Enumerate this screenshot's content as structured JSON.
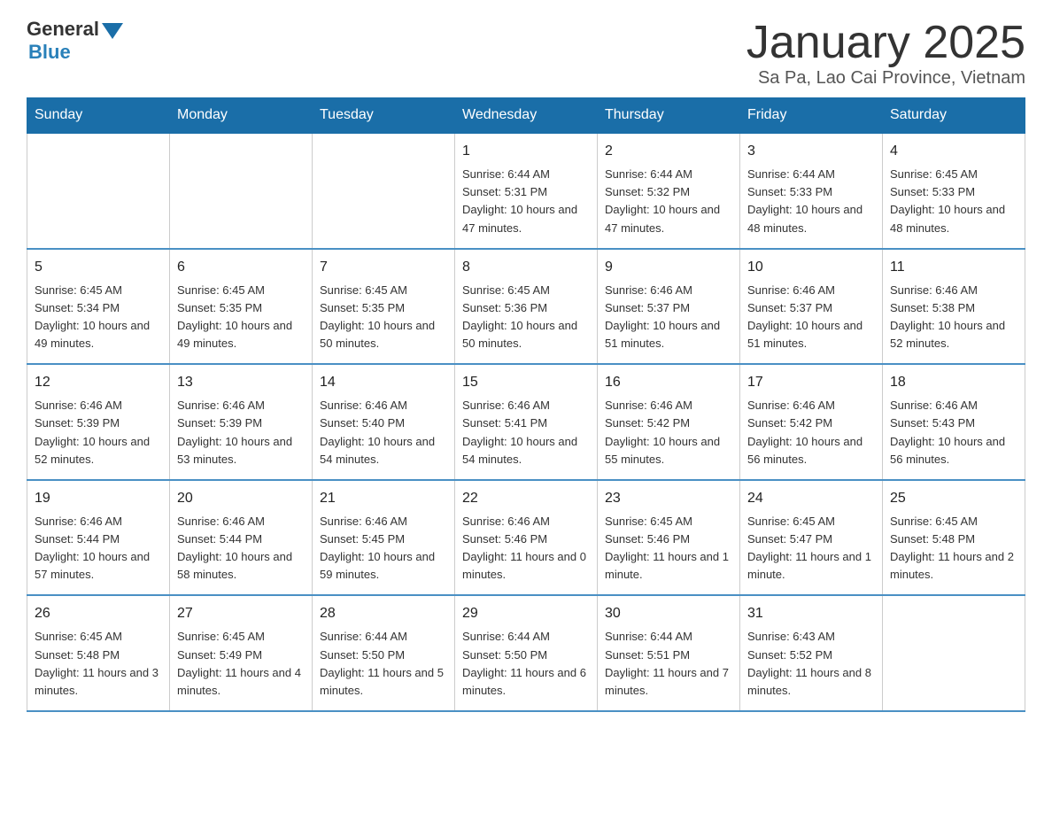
{
  "header": {
    "logo_general": "General",
    "logo_blue": "Blue",
    "title": "January 2025",
    "subtitle": "Sa Pa, Lao Cai Province, Vietnam"
  },
  "calendar": {
    "days_of_week": [
      "Sunday",
      "Monday",
      "Tuesday",
      "Wednesday",
      "Thursday",
      "Friday",
      "Saturday"
    ],
    "weeks": [
      {
        "cells": [
          {
            "day": "",
            "info": ""
          },
          {
            "day": "",
            "info": ""
          },
          {
            "day": "",
            "info": ""
          },
          {
            "day": "1",
            "info": "Sunrise: 6:44 AM\nSunset: 5:31 PM\nDaylight: 10 hours and 47 minutes."
          },
          {
            "day": "2",
            "info": "Sunrise: 6:44 AM\nSunset: 5:32 PM\nDaylight: 10 hours and 47 minutes."
          },
          {
            "day": "3",
            "info": "Sunrise: 6:44 AM\nSunset: 5:33 PM\nDaylight: 10 hours and 48 minutes."
          },
          {
            "day": "4",
            "info": "Sunrise: 6:45 AM\nSunset: 5:33 PM\nDaylight: 10 hours and 48 minutes."
          }
        ]
      },
      {
        "cells": [
          {
            "day": "5",
            "info": "Sunrise: 6:45 AM\nSunset: 5:34 PM\nDaylight: 10 hours and 49 minutes."
          },
          {
            "day": "6",
            "info": "Sunrise: 6:45 AM\nSunset: 5:35 PM\nDaylight: 10 hours and 49 minutes."
          },
          {
            "day": "7",
            "info": "Sunrise: 6:45 AM\nSunset: 5:35 PM\nDaylight: 10 hours and 50 minutes."
          },
          {
            "day": "8",
            "info": "Sunrise: 6:45 AM\nSunset: 5:36 PM\nDaylight: 10 hours and 50 minutes."
          },
          {
            "day": "9",
            "info": "Sunrise: 6:46 AM\nSunset: 5:37 PM\nDaylight: 10 hours and 51 minutes."
          },
          {
            "day": "10",
            "info": "Sunrise: 6:46 AM\nSunset: 5:37 PM\nDaylight: 10 hours and 51 minutes."
          },
          {
            "day": "11",
            "info": "Sunrise: 6:46 AM\nSunset: 5:38 PM\nDaylight: 10 hours and 52 minutes."
          }
        ]
      },
      {
        "cells": [
          {
            "day": "12",
            "info": "Sunrise: 6:46 AM\nSunset: 5:39 PM\nDaylight: 10 hours and 52 minutes."
          },
          {
            "day": "13",
            "info": "Sunrise: 6:46 AM\nSunset: 5:39 PM\nDaylight: 10 hours and 53 minutes."
          },
          {
            "day": "14",
            "info": "Sunrise: 6:46 AM\nSunset: 5:40 PM\nDaylight: 10 hours and 54 minutes."
          },
          {
            "day": "15",
            "info": "Sunrise: 6:46 AM\nSunset: 5:41 PM\nDaylight: 10 hours and 54 minutes."
          },
          {
            "day": "16",
            "info": "Sunrise: 6:46 AM\nSunset: 5:42 PM\nDaylight: 10 hours and 55 minutes."
          },
          {
            "day": "17",
            "info": "Sunrise: 6:46 AM\nSunset: 5:42 PM\nDaylight: 10 hours and 56 minutes."
          },
          {
            "day": "18",
            "info": "Sunrise: 6:46 AM\nSunset: 5:43 PM\nDaylight: 10 hours and 56 minutes."
          }
        ]
      },
      {
        "cells": [
          {
            "day": "19",
            "info": "Sunrise: 6:46 AM\nSunset: 5:44 PM\nDaylight: 10 hours and 57 minutes."
          },
          {
            "day": "20",
            "info": "Sunrise: 6:46 AM\nSunset: 5:44 PM\nDaylight: 10 hours and 58 minutes."
          },
          {
            "day": "21",
            "info": "Sunrise: 6:46 AM\nSunset: 5:45 PM\nDaylight: 10 hours and 59 minutes."
          },
          {
            "day": "22",
            "info": "Sunrise: 6:46 AM\nSunset: 5:46 PM\nDaylight: 11 hours and 0 minutes."
          },
          {
            "day": "23",
            "info": "Sunrise: 6:45 AM\nSunset: 5:46 PM\nDaylight: 11 hours and 1 minute."
          },
          {
            "day": "24",
            "info": "Sunrise: 6:45 AM\nSunset: 5:47 PM\nDaylight: 11 hours and 1 minute."
          },
          {
            "day": "25",
            "info": "Sunrise: 6:45 AM\nSunset: 5:48 PM\nDaylight: 11 hours and 2 minutes."
          }
        ]
      },
      {
        "cells": [
          {
            "day": "26",
            "info": "Sunrise: 6:45 AM\nSunset: 5:48 PM\nDaylight: 11 hours and 3 minutes."
          },
          {
            "day": "27",
            "info": "Sunrise: 6:45 AM\nSunset: 5:49 PM\nDaylight: 11 hours and 4 minutes."
          },
          {
            "day": "28",
            "info": "Sunrise: 6:44 AM\nSunset: 5:50 PM\nDaylight: 11 hours and 5 minutes."
          },
          {
            "day": "29",
            "info": "Sunrise: 6:44 AM\nSunset: 5:50 PM\nDaylight: 11 hours and 6 minutes."
          },
          {
            "day": "30",
            "info": "Sunrise: 6:44 AM\nSunset: 5:51 PM\nDaylight: 11 hours and 7 minutes."
          },
          {
            "day": "31",
            "info": "Sunrise: 6:43 AM\nSunset: 5:52 PM\nDaylight: 11 hours and 8 minutes."
          },
          {
            "day": "",
            "info": ""
          }
        ]
      }
    ]
  }
}
